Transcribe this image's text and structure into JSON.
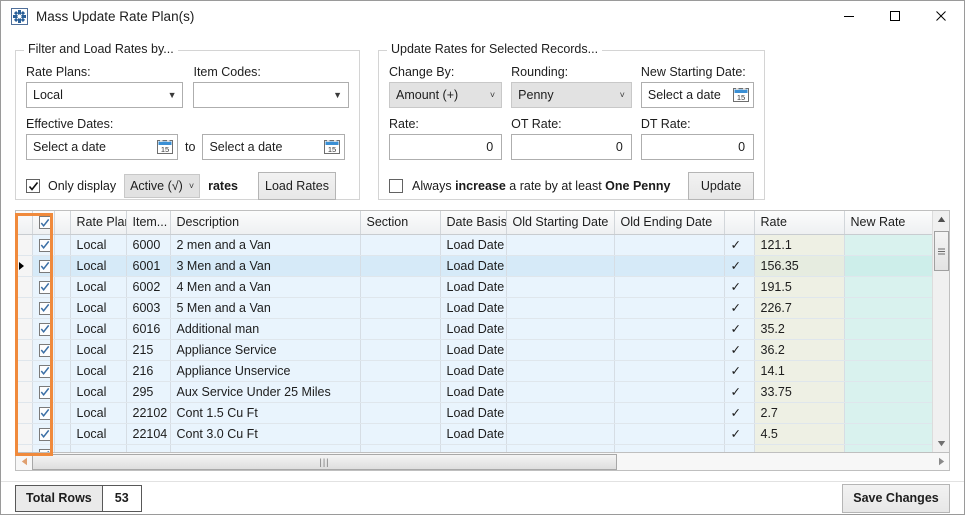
{
  "window": {
    "title": "Mass Update Rate Plan(s)",
    "icon": "gear-icon",
    "minimize_label": "─",
    "maximize_label": "□",
    "close_label": "✕"
  },
  "filter_group": {
    "legend": "Filter and Load Rates by...",
    "rate_plans_label": "Rate Plans:",
    "rate_plans_value": "Local",
    "item_codes_label": "Item Codes:",
    "item_codes_value": "",
    "effective_dates_label": "Effective Dates:",
    "effective_from_placeholder": "Select a date",
    "effective_to_separator": "to",
    "effective_to_placeholder": "Select a date",
    "only_display_checked": true,
    "only_display_label": "Only display",
    "status_filter_value": "Active (√)",
    "rates_suffix": "rates",
    "load_rates_label": "Load Rates"
  },
  "update_group": {
    "legend": "Update Rates for Selected Records...",
    "change_by_label": "Change By:",
    "change_by_value": "Amount (+)",
    "rounding_label": "Rounding:",
    "rounding_value": "Penny",
    "new_starting_date_label": "New Starting Date:",
    "new_starting_date_placeholder": "Select a date",
    "rate_label": "Rate:",
    "rate_value": "0",
    "ot_rate_label": "OT Rate:",
    "ot_rate_value": "0",
    "dt_rate_label": "DT Rate:",
    "dt_rate_value": "0",
    "always_increase_checked": false,
    "always_increase_text_1": "Always ",
    "always_increase_bold_1": "increase",
    "always_increase_text_2": " a rate by at least ",
    "always_increase_bold_2": "One Penny",
    "update_label": "Update"
  },
  "grid": {
    "select_all_checked": true,
    "columns": [
      "Rate Plan",
      "Item...",
      "Description",
      "Section",
      "Date Basis",
      "Old Starting Date",
      "Old Ending Date",
      "",
      "Rate",
      "New Rate"
    ],
    "rows": [
      {
        "checked": true,
        "selected": false,
        "rate_plan": "Local",
        "item": "6000",
        "description": "2 men and a Van",
        "section": "",
        "date_basis": "Load Date",
        "old_start": "",
        "old_end": "",
        "flag": "✓",
        "rate": "121.1",
        "new_rate": ""
      },
      {
        "checked": true,
        "selected": true,
        "rate_plan": "Local",
        "item": "6001",
        "description": "3 Men and a Van",
        "section": "",
        "date_basis": "Load Date",
        "old_start": "",
        "old_end": "",
        "flag": "✓",
        "rate": "156.35",
        "new_rate": ""
      },
      {
        "checked": true,
        "selected": false,
        "rate_plan": "Local",
        "item": "6002",
        "description": "4 Men and a Van",
        "section": "",
        "date_basis": "Load Date",
        "old_start": "",
        "old_end": "",
        "flag": "✓",
        "rate": "191.5",
        "new_rate": ""
      },
      {
        "checked": true,
        "selected": false,
        "rate_plan": "Local",
        "item": "6003",
        "description": "5 Men and a Van",
        "section": "",
        "date_basis": "Load Date",
        "old_start": "",
        "old_end": "",
        "flag": "✓",
        "rate": "226.7",
        "new_rate": ""
      },
      {
        "checked": true,
        "selected": false,
        "rate_plan": "Local",
        "item": "6016",
        "description": "Additional man",
        "section": "",
        "date_basis": "Load Date",
        "old_start": "",
        "old_end": "",
        "flag": "✓",
        "rate": "35.2",
        "new_rate": ""
      },
      {
        "checked": true,
        "selected": false,
        "rate_plan": "Local",
        "item": "215",
        "description": "Appliance Service",
        "section": "",
        "date_basis": "Load Date",
        "old_start": "",
        "old_end": "",
        "flag": "✓",
        "rate": "36.2",
        "new_rate": ""
      },
      {
        "checked": true,
        "selected": false,
        "rate_plan": "Local",
        "item": "216",
        "description": "Appliance Unservice",
        "section": "",
        "date_basis": "Load Date",
        "old_start": "",
        "old_end": "",
        "flag": "✓",
        "rate": "14.1",
        "new_rate": ""
      },
      {
        "checked": true,
        "selected": false,
        "rate_plan": "Local",
        "item": "295",
        "description": "Aux Service Under 25 Miles",
        "section": "",
        "date_basis": "Load Date",
        "old_start": "",
        "old_end": "",
        "flag": "✓",
        "rate": "33.75",
        "new_rate": ""
      },
      {
        "checked": true,
        "selected": false,
        "rate_plan": "Local",
        "item": "22102",
        "description": "Cont 1.5 Cu Ft",
        "section": "",
        "date_basis": "Load Date",
        "old_start": "",
        "old_end": "",
        "flag": "✓",
        "rate": "2.7",
        "new_rate": ""
      },
      {
        "checked": true,
        "selected": false,
        "rate_plan": "Local",
        "item": "22104",
        "description": "Cont 3.0 Cu Ft",
        "section": "",
        "date_basis": "Load Date",
        "old_start": "",
        "old_end": "",
        "flag": "✓",
        "rate": "4.5",
        "new_rate": ""
      },
      {
        "checked": true,
        "selected": false,
        "rate_plan": "",
        "item": "",
        "description": "",
        "section": "",
        "date_basis": "",
        "old_start": "",
        "old_end": "",
        "flag": "",
        "rate": "",
        "new_rate": ""
      }
    ]
  },
  "footer": {
    "total_rows_label": "Total Rows",
    "total_rows_value": "53",
    "save_changes_label": "Save Changes"
  },
  "colors": {
    "highlight_orange": "#f08a3c",
    "row_blue": "#e9f4fd",
    "row_selected": "#d6eaf8",
    "rate_col": "#eef0e4",
    "new_rate_col": "#d9f2ee"
  }
}
